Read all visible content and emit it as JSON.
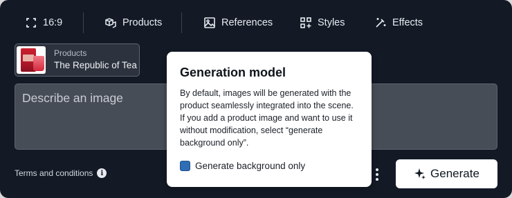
{
  "toolbar": {
    "aspect_label": "16:9",
    "products_label": "Products",
    "references_label": "References",
    "styles_label": "Styles",
    "effects_label": "Effects"
  },
  "product_chip": {
    "label": "Products",
    "value": "The Republic of Tea"
  },
  "prompt": {
    "placeholder": "Describe an image"
  },
  "footer": {
    "terms_label": "Terms and conditions",
    "info_glyph": "i",
    "generate_label": "Generate"
  },
  "popover": {
    "title": "Generation model",
    "body": "By default, images will be generated with the product seamlessly integrated into the scene. If you add a product image and want to use it without modification, select “generate background only”.",
    "checkbox_label": "Generate background only"
  },
  "colors": {
    "panel_bg": "#131a26",
    "prompt_bg": "#474d57",
    "checkbox_fill": "#2f6db5"
  }
}
